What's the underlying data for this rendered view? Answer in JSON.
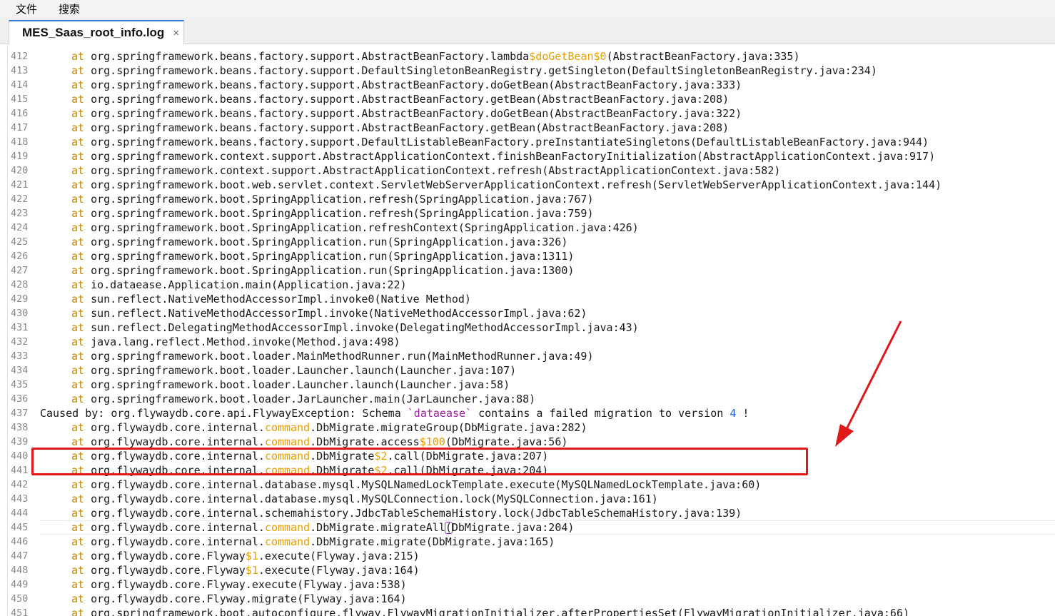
{
  "menubar": {
    "items": [
      "文件",
      "搜索"
    ]
  },
  "tabs": [
    {
      "label": "MES_Saas_root_info.log",
      "close": "×"
    }
  ],
  "colors": {
    "keyword_at": "#c18a00",
    "orange": "#e8a000",
    "purple": "#a020a0",
    "blue": "#1a5fd6",
    "annotation": "#e01818"
  },
  "editor": {
    "current_line": 445,
    "highlighted_line": 437,
    "lines": [
      {
        "n": "412",
        "segs": [
          [
            "at ",
            "kw"
          ],
          [
            "org.springframework.beans.factory.support.AbstractBeanFactory.lambda",
            ""
          ],
          [
            "$doGetBean$0",
            "o"
          ],
          [
            "(AbstractBeanFactory.java:335)",
            ""
          ]
        ]
      },
      {
        "n": "413",
        "segs": [
          [
            "at ",
            "kw"
          ],
          [
            "org.springframework.beans.factory.support.DefaultSingletonBeanRegistry.getSingleton(DefaultSingletonBeanRegistry.java:234)",
            ""
          ]
        ]
      },
      {
        "n": "414",
        "segs": [
          [
            "at ",
            "kw"
          ],
          [
            "org.springframework.beans.factory.support.AbstractBeanFactory.doGetBean(AbstractBeanFactory.java:333)",
            ""
          ]
        ]
      },
      {
        "n": "415",
        "segs": [
          [
            "at ",
            "kw"
          ],
          [
            "org.springframework.beans.factory.support.AbstractBeanFactory.getBean(AbstractBeanFactory.java:208)",
            ""
          ]
        ]
      },
      {
        "n": "416",
        "segs": [
          [
            "at ",
            "kw"
          ],
          [
            "org.springframework.beans.factory.support.AbstractBeanFactory.doGetBean(AbstractBeanFactory.java:322)",
            ""
          ]
        ]
      },
      {
        "n": "417",
        "segs": [
          [
            "at ",
            "kw"
          ],
          [
            "org.springframework.beans.factory.support.AbstractBeanFactory.getBean(AbstractBeanFactory.java:208)",
            ""
          ]
        ]
      },
      {
        "n": "418",
        "segs": [
          [
            "at ",
            "kw"
          ],
          [
            "org.springframework.beans.factory.support.DefaultListableBeanFactory.preInstantiateSingletons(DefaultListableBeanFactory.java:944)",
            ""
          ]
        ]
      },
      {
        "n": "419",
        "segs": [
          [
            "at ",
            "kw"
          ],
          [
            "org.springframework.context.support.AbstractApplicationContext.finishBeanFactoryInitialization(AbstractApplicationContext.java:917)",
            ""
          ]
        ]
      },
      {
        "n": "420",
        "segs": [
          [
            "at ",
            "kw"
          ],
          [
            "org.springframework.context.support.AbstractApplicationContext.refresh(AbstractApplicationContext.java:582)",
            ""
          ]
        ]
      },
      {
        "n": "421",
        "segs": [
          [
            "at ",
            "kw"
          ],
          [
            "org.springframework.boot.web.servlet.context.ServletWebServerApplicationContext.refresh(ServletWebServerApplicationContext.java:144)",
            ""
          ]
        ]
      },
      {
        "n": "422",
        "segs": [
          [
            "at ",
            "kw"
          ],
          [
            "org.springframework.boot.SpringApplication.refresh(SpringApplication.java:767)",
            ""
          ]
        ]
      },
      {
        "n": "423",
        "segs": [
          [
            "at ",
            "kw"
          ],
          [
            "org.springframework.boot.SpringApplication.refresh(SpringApplication.java:759)",
            ""
          ]
        ]
      },
      {
        "n": "424",
        "segs": [
          [
            "at ",
            "kw"
          ],
          [
            "org.springframework.boot.SpringApplication.refreshContext(SpringApplication.java:426)",
            ""
          ]
        ]
      },
      {
        "n": "425",
        "segs": [
          [
            "at ",
            "kw"
          ],
          [
            "org.springframework.boot.SpringApplication.run(SpringApplication.java:326)",
            ""
          ]
        ]
      },
      {
        "n": "426",
        "segs": [
          [
            "at ",
            "kw"
          ],
          [
            "org.springframework.boot.SpringApplication.run(SpringApplication.java:1311)",
            ""
          ]
        ]
      },
      {
        "n": "427",
        "segs": [
          [
            "at ",
            "kw"
          ],
          [
            "org.springframework.boot.SpringApplication.run(SpringApplication.java:1300)",
            ""
          ]
        ]
      },
      {
        "n": "428",
        "segs": [
          [
            "at ",
            "kw"
          ],
          [
            "io.dataease.Application.main(Application.java:22)",
            ""
          ]
        ]
      },
      {
        "n": "429",
        "segs": [
          [
            "at ",
            "kw"
          ],
          [
            "sun.reflect.NativeMethodAccessorImpl.invoke0(Native Method)",
            ""
          ]
        ]
      },
      {
        "n": "430",
        "segs": [
          [
            "at ",
            "kw"
          ],
          [
            "sun.reflect.NativeMethodAccessorImpl.invoke(NativeMethodAccessorImpl.java:62)",
            ""
          ]
        ]
      },
      {
        "n": "431",
        "segs": [
          [
            "at ",
            "kw"
          ],
          [
            "sun.reflect.DelegatingMethodAccessorImpl.invoke(DelegatingMethodAccessorImpl.java:43)",
            ""
          ]
        ]
      },
      {
        "n": "432",
        "segs": [
          [
            "at ",
            "kw"
          ],
          [
            "java.lang.reflect.Method.invoke(Method.java:498)",
            ""
          ]
        ]
      },
      {
        "n": "433",
        "segs": [
          [
            "at ",
            "kw"
          ],
          [
            "org.springframework.boot.loader.MainMethodRunner.run(MainMethodRunner.java:49)",
            ""
          ]
        ]
      },
      {
        "n": "434",
        "segs": [
          [
            "at ",
            "kw"
          ],
          [
            "org.springframework.boot.loader.Launcher.launch(Launcher.java:107)",
            ""
          ]
        ]
      },
      {
        "n": "435",
        "segs": [
          [
            "at ",
            "kw"
          ],
          [
            "org.springframework.boot.loader.Launcher.launch(Launcher.java:58)",
            ""
          ]
        ]
      },
      {
        "n": "436",
        "segs": [
          [
            "at ",
            "kw"
          ],
          [
            "org.springframework.boot.loader.JarLauncher.main(JarLauncher.java:88)",
            ""
          ]
        ]
      },
      {
        "n": "437",
        "segs": [
          [
            "Caused by: org.flywaydb.core.api.FlywayException: Schema ",
            ""
          ],
          [
            "`dataease`",
            "p"
          ],
          [
            " contains a failed migration to version ",
            ""
          ],
          [
            "4",
            "b"
          ],
          [
            " !",
            ""
          ]
        ]
      },
      {
        "n": "438",
        "segs": [
          [
            "at ",
            "kw"
          ],
          [
            "org.flywaydb.core.internal.",
            ""
          ],
          [
            "command",
            "o"
          ],
          [
            ".DbMigrate.migrateGroup(DbMigrate.java:282)",
            ""
          ]
        ]
      },
      {
        "n": "439",
        "segs": [
          [
            "at ",
            "kw"
          ],
          [
            "org.flywaydb.core.internal.",
            ""
          ],
          [
            "command",
            "o"
          ],
          [
            ".DbMigrate.access",
            ""
          ],
          [
            "$100",
            "o"
          ],
          [
            "(DbMigrate.java:56)",
            ""
          ]
        ]
      },
      {
        "n": "440",
        "segs": [
          [
            "at ",
            "kw"
          ],
          [
            "org.flywaydb.core.internal.",
            ""
          ],
          [
            "command",
            "o"
          ],
          [
            ".DbMigrate",
            ""
          ],
          [
            "$2",
            "o"
          ],
          [
            ".call(DbMigrate.java:207)",
            ""
          ]
        ]
      },
      {
        "n": "441",
        "segs": [
          [
            "at ",
            "kw"
          ],
          [
            "org.flywaydb.core.internal.",
            ""
          ],
          [
            "command",
            "o"
          ],
          [
            ".DbMigrate",
            ""
          ],
          [
            "$2",
            "o"
          ],
          [
            ".call(DbMigrate.java:204)",
            ""
          ]
        ]
      },
      {
        "n": "442",
        "segs": [
          [
            "at ",
            "kw"
          ],
          [
            "org.flywaydb.core.internal.database.mysql.MySQLNamedLockTemplate.execute(MySQLNamedLockTemplate.java:60)",
            ""
          ]
        ]
      },
      {
        "n": "443",
        "segs": [
          [
            "at ",
            "kw"
          ],
          [
            "org.flywaydb.core.internal.database.mysql.MySQLConnection.lock(MySQLConnection.java:161)",
            ""
          ]
        ]
      },
      {
        "n": "444",
        "segs": [
          [
            "at ",
            "kw"
          ],
          [
            "org.flywaydb.core.internal.schemahistory.JdbcTableSchemaHistory.lock(JdbcTableSchemaHistory.java:139)",
            ""
          ]
        ]
      },
      {
        "n": "445",
        "segs": [
          [
            "at ",
            "kw"
          ],
          [
            "org.flywaydb.core.internal.",
            ""
          ],
          [
            "command",
            "o"
          ],
          [
            ".DbMigrate.migrateAll",
            ""
          ],
          [
            "(",
            "c"
          ],
          [
            "DbMigrate.java:204)",
            ""
          ]
        ]
      },
      {
        "n": "446",
        "segs": [
          [
            "at ",
            "kw"
          ],
          [
            "org.flywaydb.core.internal.",
            ""
          ],
          [
            "command",
            "o"
          ],
          [
            ".DbMigrate.migrate(DbMigrate.java:165)",
            ""
          ]
        ]
      },
      {
        "n": "447",
        "segs": [
          [
            "at ",
            "kw"
          ],
          [
            "org.flywaydb.core.Flyway",
            ""
          ],
          [
            "$1",
            "o"
          ],
          [
            ".execute(Flyway.java:215)",
            ""
          ]
        ]
      },
      {
        "n": "448",
        "segs": [
          [
            "at ",
            "kw"
          ],
          [
            "org.flywaydb.core.Flyway",
            ""
          ],
          [
            "$1",
            "o"
          ],
          [
            ".execute(Flyway.java:164)",
            ""
          ]
        ]
      },
      {
        "n": "449",
        "segs": [
          [
            "at ",
            "kw"
          ],
          [
            "org.flywaydb.core.Flyway.execute(Flyway.java:538)",
            ""
          ]
        ]
      },
      {
        "n": "450",
        "segs": [
          [
            "at ",
            "kw"
          ],
          [
            "org.flywaydb.core.Flyway.migrate(Flyway.java:164)",
            ""
          ]
        ]
      },
      {
        "n": "451",
        "segs": [
          [
            "at ",
            "kw"
          ],
          [
            "org.springframework.boot.autoconfigure.flyway.FlywayMigrationInitializer.afterPropertiesSet(FlywayMigrationInitializer.java:66)",
            ""
          ]
        ]
      }
    ]
  }
}
